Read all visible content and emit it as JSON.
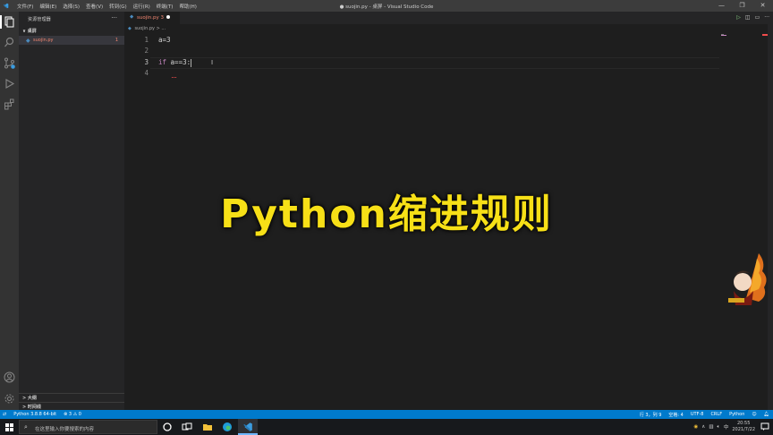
{
  "window": {
    "title": "● suojin.py - 桌屏 - Visual Studio Code"
  },
  "menu": [
    "文件(F)",
    "编辑(E)",
    "选择(S)",
    "查看(V)",
    "转到(G)",
    "运行(R)",
    "终端(T)",
    "帮助(H)"
  ],
  "sidebar": {
    "header": "资源管理器",
    "more": "···",
    "folder": "∨ 桌屏",
    "file": {
      "name": "suojin.py",
      "problems": "1"
    },
    "outline": "> 大纲",
    "timeline": "> 时间线"
  },
  "tab": {
    "name": "suojin.py 3"
  },
  "breadcrumb": {
    "file": "suojin.py",
    "rest": "> ..."
  },
  "editor": {
    "lines": [
      {
        "num": "1",
        "text": "a=3"
      },
      {
        "num": "2",
        "text": ""
      },
      {
        "num": "3",
        "kw": "if",
        "text": " a==3:"
      },
      {
        "num": "4",
        "text": ""
      }
    ]
  },
  "overlay": {
    "caption": "Python缩进规则"
  },
  "status": {
    "python": "Python 3.8.8 64-bit",
    "problems": "⊗ 3 ⚠ 0",
    "position": "行 3，列 9",
    "spaces": "空格: 4",
    "encoding": "UTF-8",
    "eol": "CRLF",
    "language": "Python"
  },
  "taskbar": {
    "search_placeholder": "在这里输入你要搜索的内容",
    "time": "20:55",
    "date": "2021/7/22"
  },
  "colors": {
    "accent": "#007acc",
    "caption": "#f7e017",
    "error": "#f48771"
  }
}
